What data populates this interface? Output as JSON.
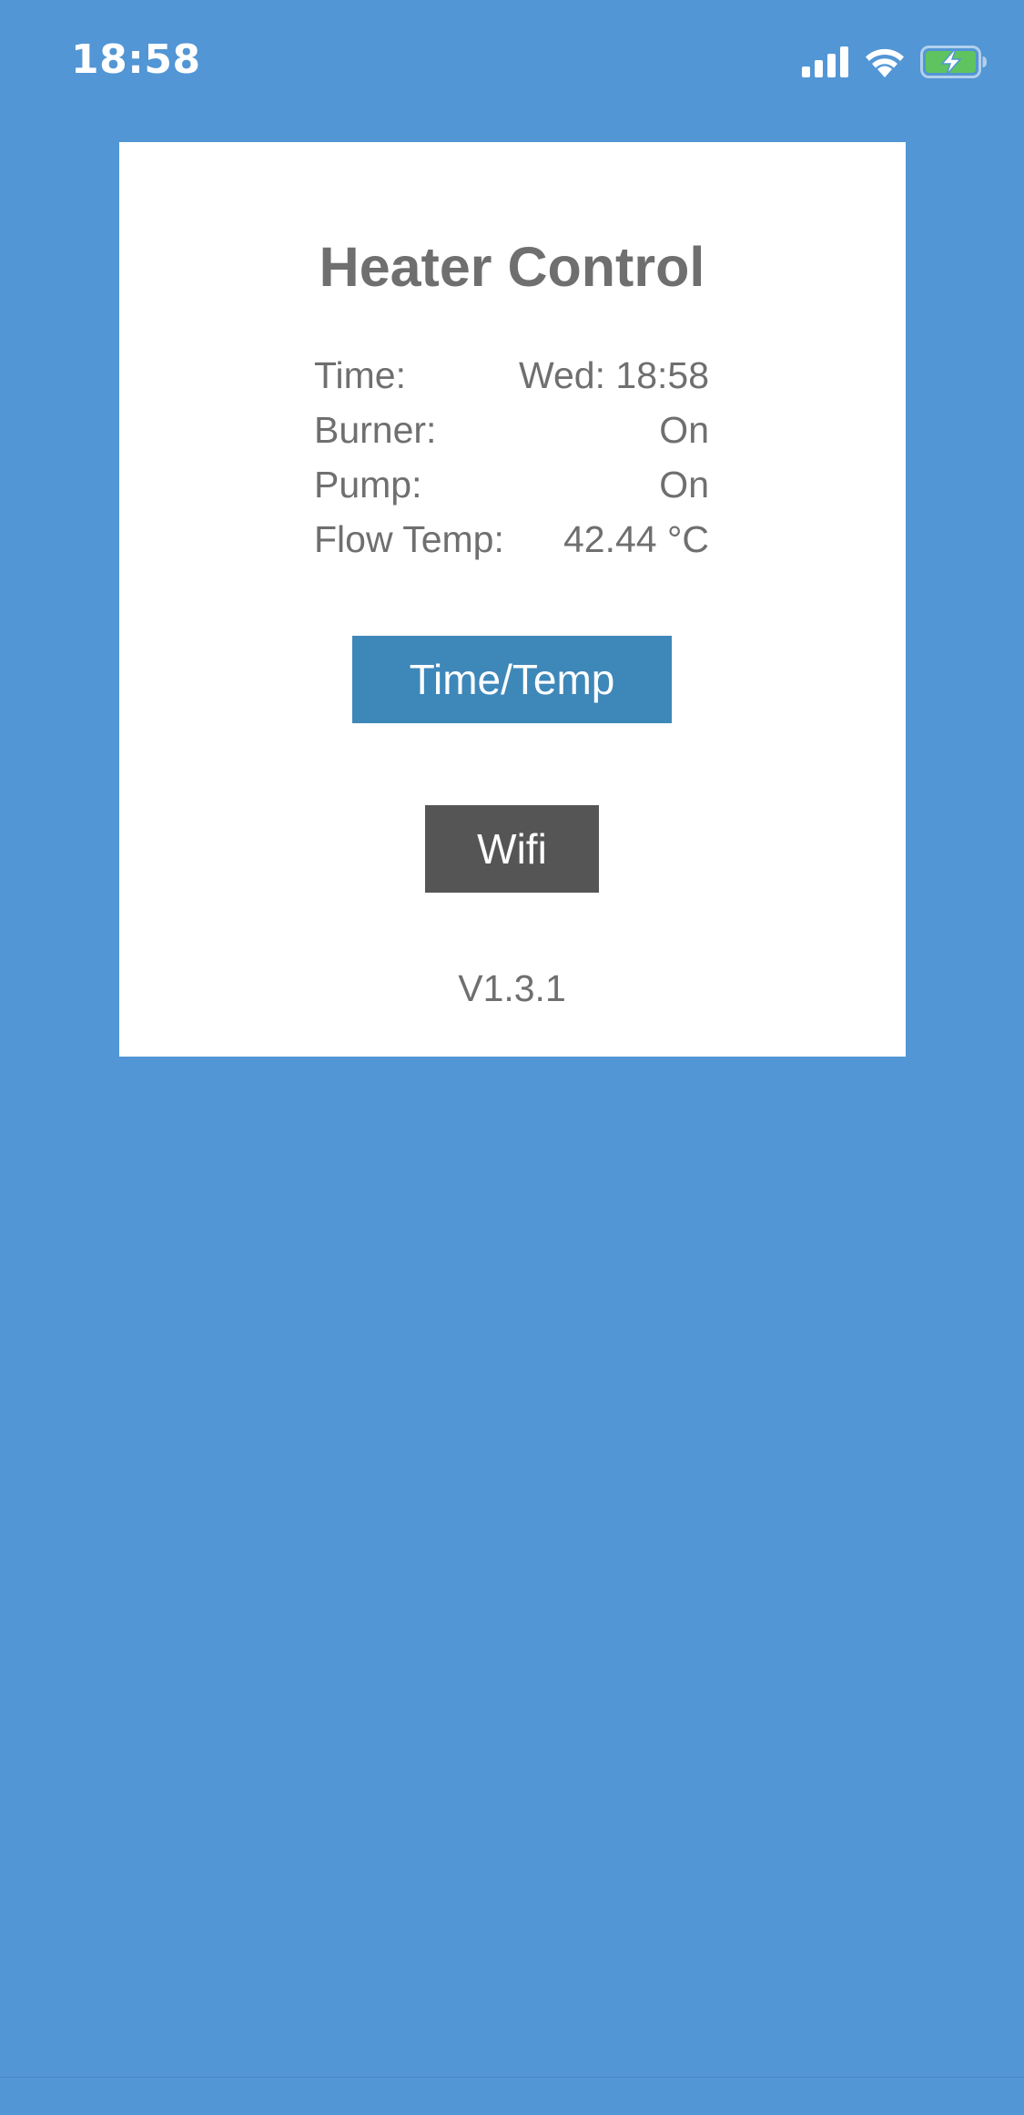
{
  "status_bar": {
    "time": "18:58",
    "icons": [
      "cellular-signal-icon",
      "wifi-icon",
      "battery-charging-icon"
    ]
  },
  "colors": {
    "background": "#5296d5",
    "card": "#ffffff",
    "text": "#6f6f6f",
    "primary_button": "#3e87b9",
    "secondary_button": "#555555",
    "battery_fill": "#5fc35f"
  },
  "card": {
    "title": "Heater Control",
    "info": [
      {
        "label": "Time:",
        "value": "Wed: 18:58"
      },
      {
        "label": "Burner:",
        "value": "On"
      },
      {
        "label": "Pump:",
        "value": "On"
      },
      {
        "label": "Flow Temp:",
        "value": "42.44 °C"
      }
    ],
    "buttons": {
      "time_temp": "Time/Temp",
      "wifi": "Wifi"
    },
    "version": "V1.3.1"
  }
}
